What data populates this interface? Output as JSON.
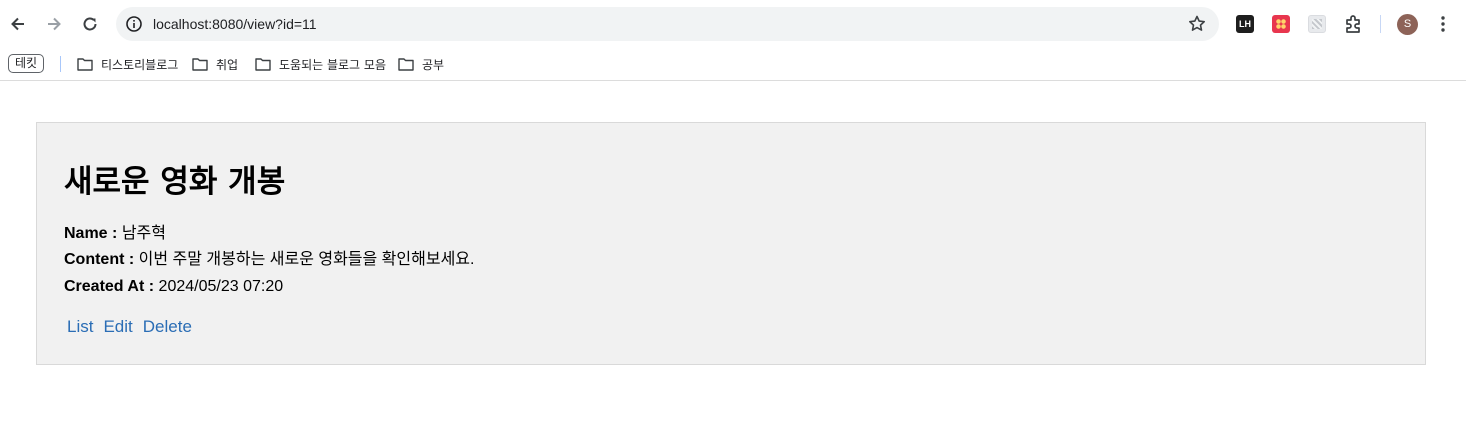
{
  "browser": {
    "url": "localhost:8080/view?id=11",
    "avatar_letter": "S",
    "extensions": [
      "LH",
      "",
      ""
    ]
  },
  "bookmarks": {
    "chip": "테킷",
    "items": [
      {
        "label": "티스토리블로그",
        "icon": "folder-icon"
      },
      {
        "label": "취업",
        "icon": "folder-icon"
      },
      {
        "label": "도움되는 블로그 모음",
        "icon": "folder-icon"
      },
      {
        "label": "공부",
        "icon": "folder-icon"
      }
    ]
  },
  "post": {
    "title": "새로운 영화 개봉",
    "name_label": "Name :",
    "name_value": "남주혁",
    "content_label": "Content :",
    "content_value": "이번 주말 개봉하는 새로운 영화들을 확인해보세요.",
    "created_label": "Created At :",
    "created_value": "2024/05/23 07:20"
  },
  "actions": {
    "list": "List",
    "edit": "Edit",
    "delete": "Delete"
  },
  "colors": {
    "link": "#2a6db5",
    "card_bg": "#f1f1f1"
  }
}
